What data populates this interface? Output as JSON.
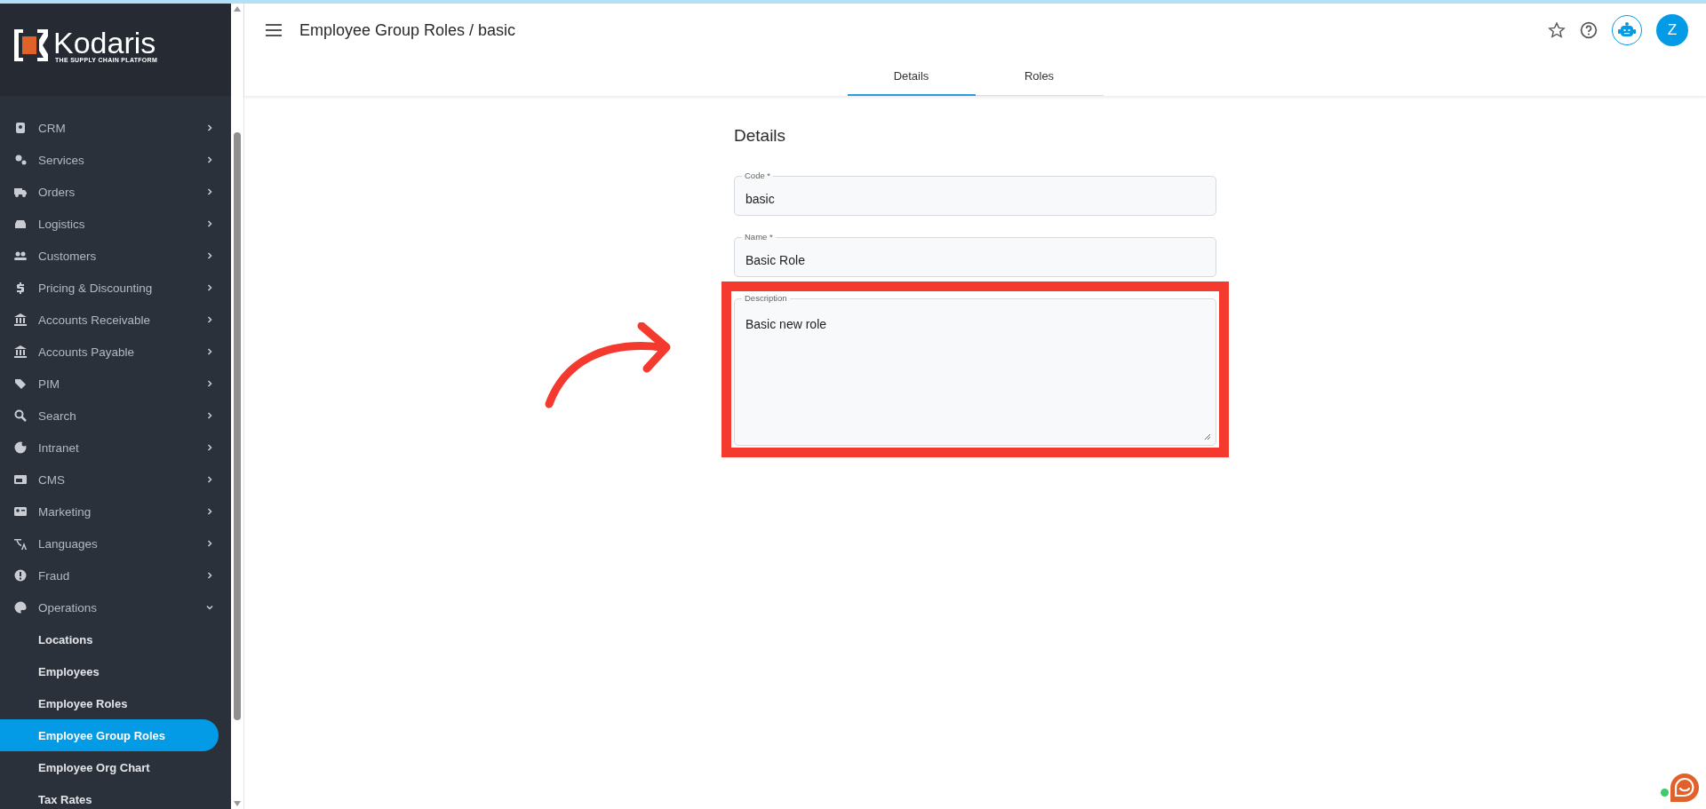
{
  "sidebar": {
    "logo": {
      "name": "Kodaris",
      "tagline": "THE SUPPLY CHAIN PLATFORM"
    },
    "items": [
      {
        "label": "CRM",
        "expanded": false
      },
      {
        "label": "Services",
        "expanded": false
      },
      {
        "label": "Orders",
        "expanded": false
      },
      {
        "label": "Logistics",
        "expanded": false
      },
      {
        "label": "Customers",
        "expanded": false
      },
      {
        "label": "Pricing & Discounting",
        "expanded": false
      },
      {
        "label": "Accounts Receivable",
        "expanded": false
      },
      {
        "label": "Accounts Payable",
        "expanded": false
      },
      {
        "label": "PIM",
        "expanded": false
      },
      {
        "label": "Search",
        "expanded": false
      },
      {
        "label": "Intranet",
        "expanded": false
      },
      {
        "label": "CMS",
        "expanded": false
      },
      {
        "label": "Marketing",
        "expanded": false
      },
      {
        "label": "Languages",
        "expanded": false
      },
      {
        "label": "Fraud",
        "expanded": false
      },
      {
        "label": "Operations",
        "expanded": true,
        "children": [
          {
            "label": "Locations",
            "selected": false
          },
          {
            "label": "Employees",
            "selected": false
          },
          {
            "label": "Employee Roles",
            "selected": false
          },
          {
            "label": "Employee Group Roles",
            "selected": true
          },
          {
            "label": "Employee Org Chart",
            "selected": false
          },
          {
            "label": "Tax Rates",
            "selected": false
          }
        ]
      }
    ]
  },
  "header": {
    "title": "Employee Group Roles / basic",
    "avatar": "Z"
  },
  "tabs": [
    {
      "label": "Details",
      "selected": true
    },
    {
      "label": "Roles",
      "selected": false
    }
  ],
  "form": {
    "heading": "Details",
    "fields": [
      {
        "kind": "input",
        "label": "Code *",
        "value": "basic",
        "highlighted": false
      },
      {
        "kind": "input",
        "label": "Name *",
        "value": "Basic Role",
        "highlighted": false
      },
      {
        "kind": "textarea",
        "label": "Description",
        "value": "Basic new role",
        "highlighted": true
      }
    ]
  }
}
